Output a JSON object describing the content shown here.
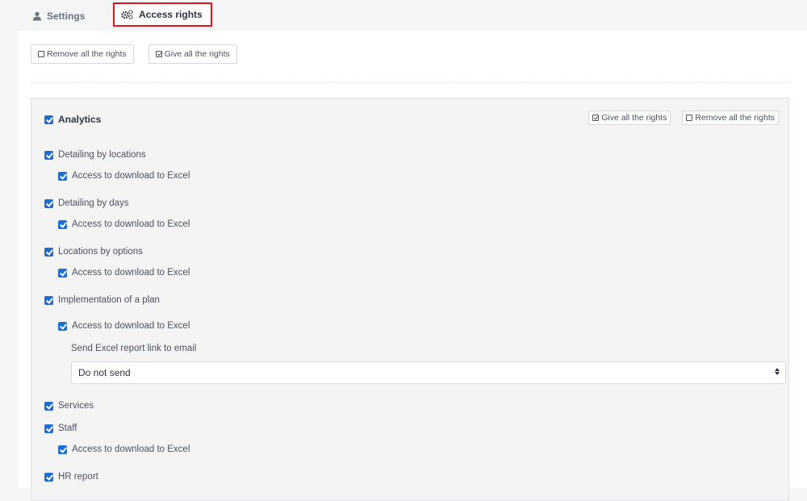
{
  "tabs": {
    "settings": "Settings",
    "access": "Access rights"
  },
  "top_buttons": {
    "remove_all": "Remove all the rights",
    "give_all": "Give all the rights"
  },
  "section": {
    "title": "Analytics",
    "give_all": "Give all the rights",
    "remove_all": "Remove all the rights",
    "items": [
      {
        "label": "Detailing by locations",
        "checked": true
      },
      {
        "label": "Access to download to Excel",
        "checked": true
      },
      {
        "label": "Detailing by days",
        "checked": true
      },
      {
        "label": "Access to download to Excel",
        "checked": true
      },
      {
        "label": "Locations by options",
        "checked": true
      },
      {
        "label": "Access to download to Excel",
        "checked": true
      },
      {
        "label": "Implementation of a plan",
        "checked": true
      },
      {
        "label": "Access to download to Excel",
        "checked": true
      },
      {
        "label": "Services",
        "checked": true
      },
      {
        "label": "Staff",
        "checked": true
      },
      {
        "label": "Access to download to Excel",
        "checked": true
      },
      {
        "label": "HR report",
        "checked": true
      }
    ],
    "email_report_label": "Send Excel report link to email",
    "email_report_select": "Do not send"
  }
}
